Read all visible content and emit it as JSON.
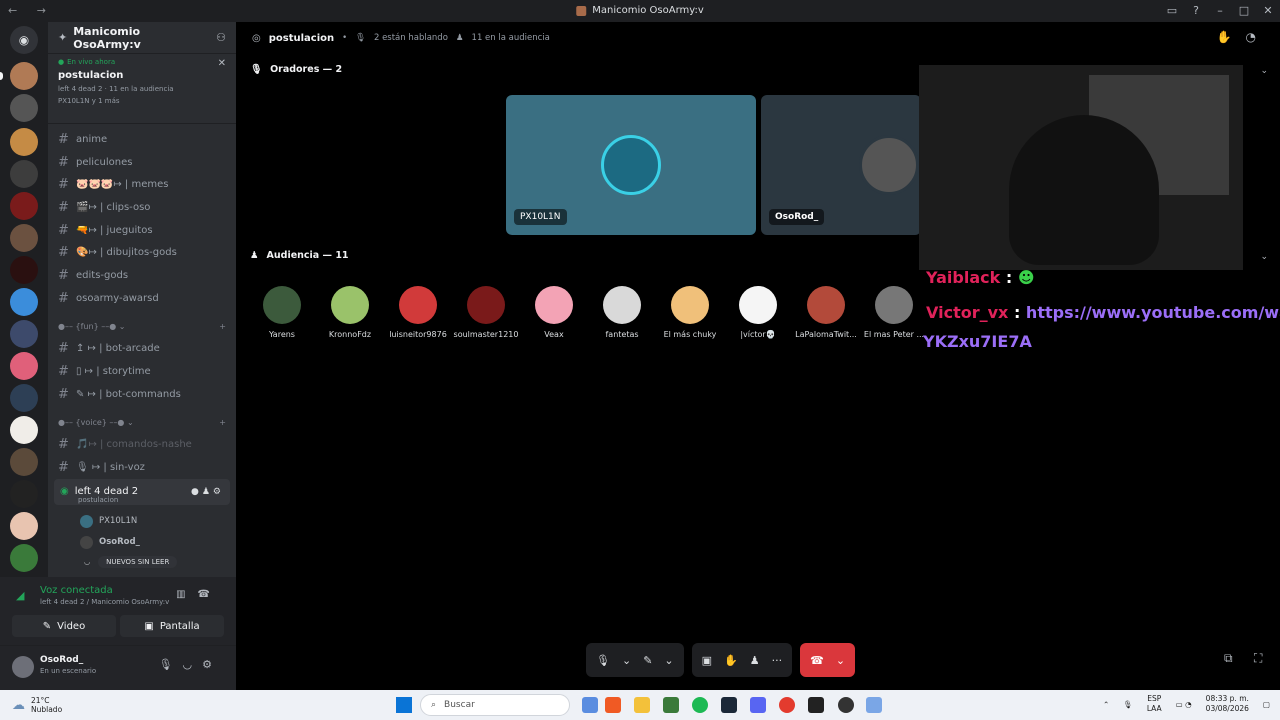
{
  "window": {
    "title": "Manicomio OsoArmy:v",
    "nav_glyphs": "← →",
    "controls": [
      "▭",
      "?",
      "–",
      "□",
      "✕"
    ]
  },
  "server": {
    "name": "Manicomio OsoArmy:v"
  },
  "live": {
    "now": "En vivo ahora",
    "name": "postulacion",
    "meta": "left 4 dead 2 · 11 en la audiencia",
    "who": "PX10L1N y 1 más"
  },
  "channels": [
    {
      "name": "anime"
    },
    {
      "name": "peliculones"
    },
    {
      "name": "🐷🐷🐷↦ | memes"
    },
    {
      "name": "🎬↦ | clips-oso"
    },
    {
      "name": "🔫↦ | jueguitos"
    },
    {
      "name": "🎨↦ | dibujitos-gods"
    },
    {
      "name": "edits-gods"
    },
    {
      "name": "osoarmy-awarsd"
    }
  ],
  "category_fun": "●–– {fun} ––● ⌄",
  "channels_fun": [
    {
      "name": "↥ ↦ | bot-arcade"
    },
    {
      "name": "▯ ↦ | storytime"
    },
    {
      "name": "✎ ↦ | bot-commands"
    }
  ],
  "category_voice": "●–– {voice} ––● ⌄",
  "channels_voice": [
    {
      "name": "🎵↦ | comandos-nashe"
    },
    {
      "name": "🎙 ↦ | sin-voz"
    }
  ],
  "voice_channel": {
    "name": "left 4 dead 2",
    "sub": "postulacion"
  },
  "voice_users": [
    "PX10L1N",
    "OsoRod_"
  ],
  "new_unread": "NUEVOS SIN LEER",
  "voicebar": {
    "status": "Voz conectada",
    "sub": "left 4 dead 2 / Manicomio OsoArmy:v",
    "video": "Video",
    "screen": "Pantalla"
  },
  "user": {
    "name": "OsoRod_",
    "status": "En un escenario"
  },
  "topbar": {
    "title": "postulacion",
    "speaking": "2 están hablando",
    "audience": "11 en la audiencia"
  },
  "speakers_header": "Oradores — 2",
  "speakers": [
    {
      "name": "PX10L1N",
      "color": "#3a6f82"
    },
    {
      "name": "OsoRod_",
      "color": "#2b3740"
    }
  ],
  "audience_header": "Audiencia — 11",
  "audience": [
    {
      "name": "Yarens",
      "color": "#3c5a3c"
    },
    {
      "name": "KronnoFdz",
      "color": "#9ac26a"
    },
    {
      "name": "luisneitor9876",
      "color": "#d13a3a"
    },
    {
      "name": "soulmaster1210",
      "color": "#7a1a1a"
    },
    {
      "name": "Veax",
      "color": "#f3a3b5"
    },
    {
      "name": "fantetas",
      "color": "#d9d9d9"
    },
    {
      "name": "El más chuky",
      "color": "#f0c07a"
    },
    {
      "name": "|víctor💀",
      "color": "#f5f5f5"
    },
    {
      "name": "LaPalomaTwit...",
      "color": "#b34a3a"
    },
    {
      "name": "El mas Peter ...",
      "color": "#777777"
    }
  ],
  "chat": {
    "line1_user": "Yaiblack",
    "line2_user": "Victor_vx",
    "line2_link": "https://www.youtube.com/watc",
    "line3": "YKZxu7IE7A"
  },
  "taskbar": {
    "temp": "21°C",
    "weather": "Nublado",
    "search": "Buscar",
    "lang1": "ESP",
    "lang2": "LAA",
    "time": "08:33 p. m.",
    "date": "03/08/2026"
  }
}
